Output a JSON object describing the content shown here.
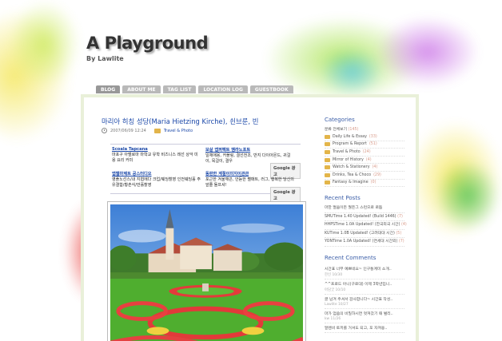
{
  "header": {
    "title": "A Playground",
    "subtitle": "By Lawlite"
  },
  "nav": {
    "tabs": [
      {
        "label": "BLOG",
        "active": true
      },
      {
        "label": "ABOUT ME",
        "active": false
      },
      {
        "label": "TAG LIST",
        "active": false
      },
      {
        "label": "LOCATION LOG",
        "active": false
      },
      {
        "label": "GUESTBOOK",
        "active": false
      }
    ]
  },
  "post": {
    "title": "마리아 히칭 성당(Maria Hietzing Kirche), 쇤브룬, 빈",
    "date": "2007/06/09 12:24",
    "category": "Travel & Photo",
    "photo_icon": "church-garden-photo"
  },
  "ads": {
    "items": [
      {
        "title": "Scoala Tapcana",
        "text": "마포구 아벨로마 마학교 유학 비즈니스 레선 상악 미용 요리 커미"
      },
      {
        "title": "보살 앱퍼펙트 멤라노포트",
        "text": "일체애용, 커플링, 결선전조, 반지 다이아몬드, 귀걸이, 목걸이, 결우"
      },
      {
        "title": "앱웹마제트 공스터디오",
        "text": "영플노선스/내 지협에다 크업/웨딩촬영 인전웨딩홀 주유결합/황촌식/만홀촬영"
      },
      {
        "title": "동판한 계절이미지이관관",
        "text": "포근한 겨울깨끈, 안듣한 펠매트, 러그, 행복한 당신의 앞줄 둘프셔!"
      }
    ],
    "badge": "Google 광고"
  },
  "sidebar": {
    "categories": {
      "heading": "Categories",
      "all": {
        "label": "분류 전체보기",
        "count": "(145)"
      },
      "items": [
        {
          "label": "Daily Life & Essay",
          "count": "(33)"
        },
        {
          "label": "Program & Report",
          "count": "(51)"
        },
        {
          "label": "Travel & Photo",
          "count": "(24)"
        },
        {
          "label": "Mirror of History",
          "count": "(4)"
        },
        {
          "label": "Watch & Stationery",
          "count": "(4)"
        },
        {
          "label": "Drinks, Tea & Choco",
          "count": "(29)"
        },
        {
          "label": "Fantasy & Imagine",
          "count": "(0)"
        }
      ]
    },
    "recent_posts": {
      "heading": "Recent Posts",
      "items": [
        {
          "title": "마한 멀움이든 월든그 스런으로 로돔",
          "count": ""
        },
        {
          "title": "SMUTime 1.40 Updated! (Build 1446)",
          "count": "(7)"
        },
        {
          "title": "HHPSTime 1.0A Updated! (한국외국 시간)",
          "count": "(4)"
        },
        {
          "title": "KUTime 1.0B Updated! (고려대대 시간)",
          "count": "(5)"
        },
        {
          "title": "YONTime 1.0A Updated! (연세대 시간외)",
          "count": "(7)"
        }
      ]
    },
    "recent_comments": {
      "heading": "Recent Comments",
      "items": [
        {
          "text": "시간표 너무 예쁘네요~ 인구통계미 소개..",
          "author": "한신 10/30"
        },
        {
          "text": "^^프로드 아니(구로대) 이제 3학년입니..",
          "author": "아담굿 10/10"
        },
        {
          "text": "글 남겨 주셔서 감사합니다~ 시간표 작성..",
          "author": "Lawlite 10/27"
        },
        {
          "text": "마가 엄씀의 비밀하시면 멋져갔기 때 벌리..",
          "author": "kw 11/26"
        },
        {
          "text": "알렌비 토끼를 거셔도 되고, 포 자져용..",
          "author": ""
        }
      ]
    }
  }
}
